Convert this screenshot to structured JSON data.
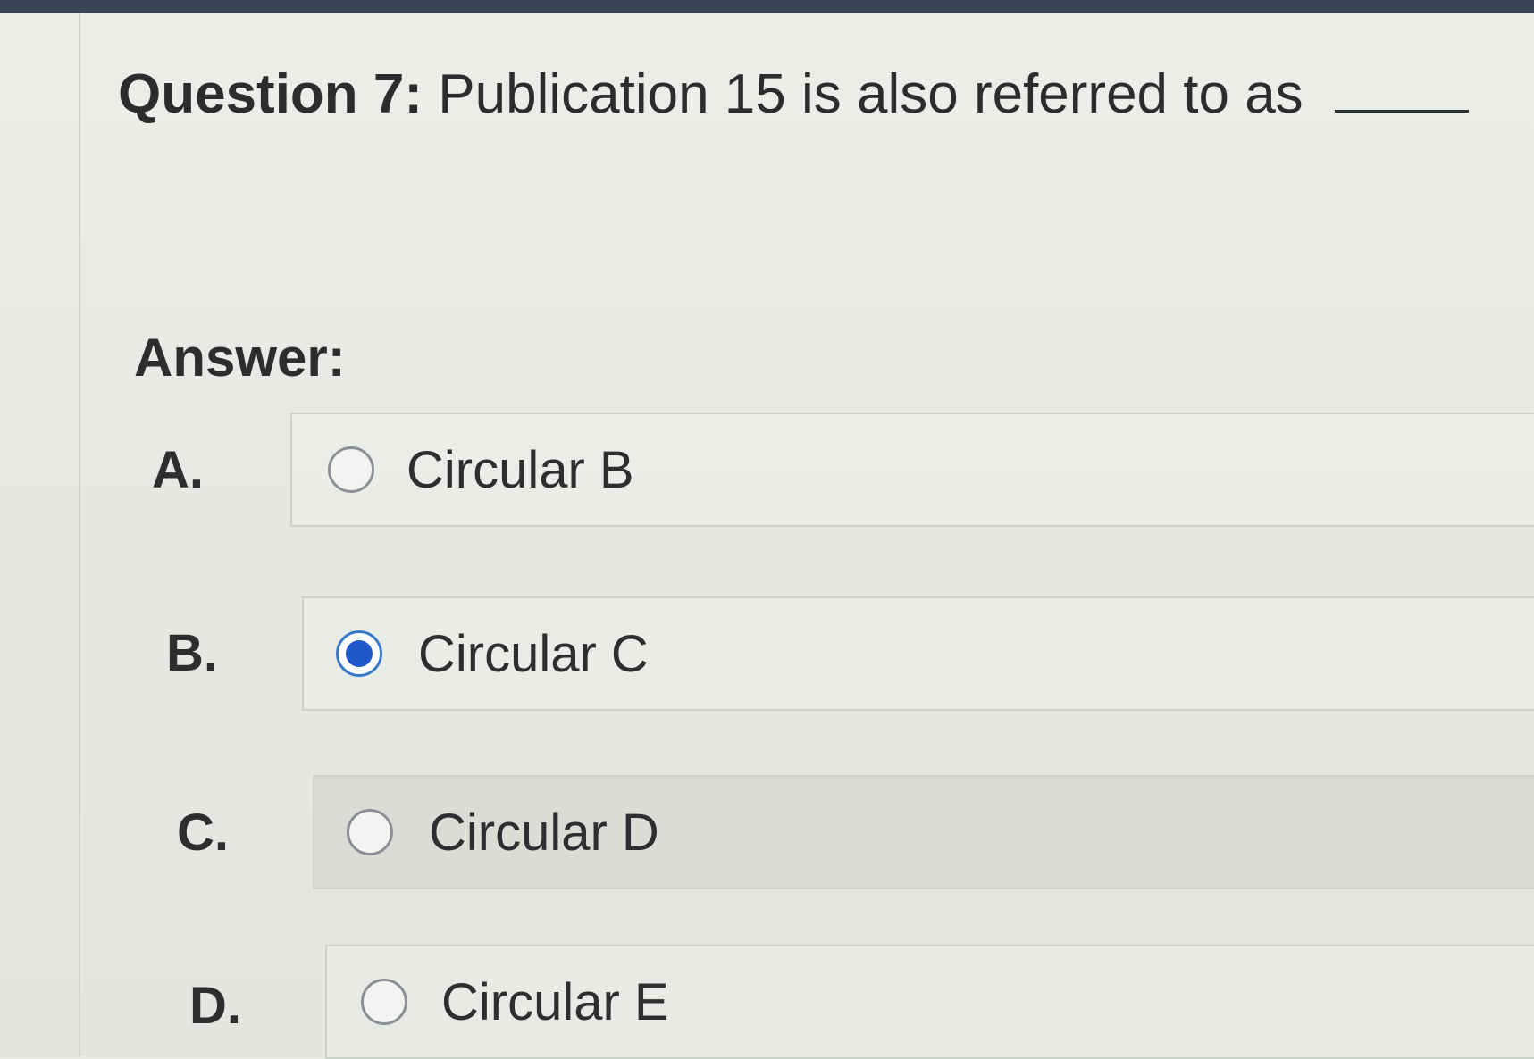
{
  "question": {
    "number_label": "Question 7:",
    "text": "Publication 15 is also referred to as"
  },
  "answer_label": "Answer:",
  "options": [
    {
      "letter": "A.",
      "text": "Circular B",
      "selected": false
    },
    {
      "letter": "B.",
      "text": "Circular C",
      "selected": true
    },
    {
      "letter": "C.",
      "text": "Circular D",
      "selected": false
    },
    {
      "letter": "D.",
      "text": "Circular E",
      "selected": false
    }
  ],
  "colors": {
    "selected_radio": "#1f58c9",
    "background": "#e7e9e4"
  }
}
